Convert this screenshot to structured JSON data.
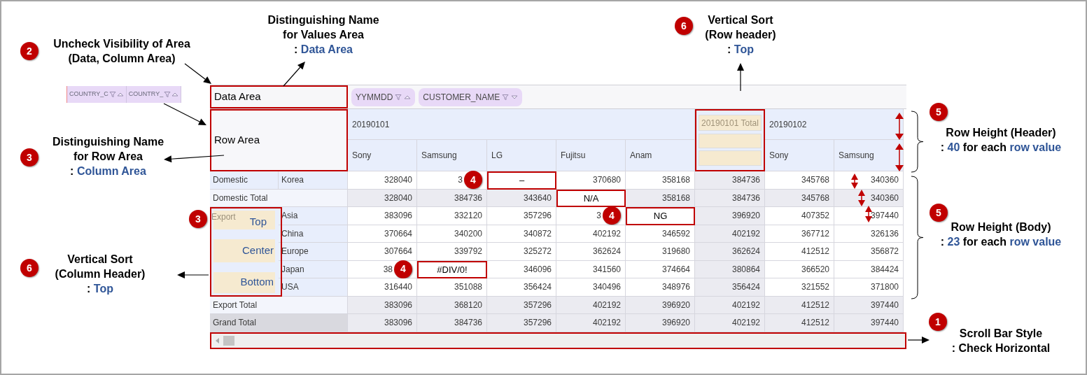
{
  "floating_fields": [
    {
      "label": "COUNTRY_C",
      "descending": false
    },
    {
      "label": "COUNTRY_",
      "descending": false
    }
  ],
  "grid": {
    "toolbar": {
      "data_area_label": "Data Area",
      "column_fields": [
        {
          "label": "YYMMDD",
          "descending": false
        },
        {
          "label": "CUSTOMER_NAME",
          "descending": true
        }
      ]
    },
    "row_area_label": "Row Area",
    "column_groups": [
      {
        "kind": "date",
        "label": "20190101",
        "members": [
          "Sony",
          "Samsung",
          "LG",
          "Fujitsu",
          "Anam"
        ]
      },
      {
        "kind": "total",
        "label": "20190101 Total"
      },
      {
        "kind": "date",
        "label": "20190102",
        "members": [
          "Sony",
          "Samsung"
        ]
      }
    ],
    "row_groups": [
      {
        "label": "Domestic",
        "rows": [
          {
            "label": "Korea",
            "cells": [
              {
                "value": "328040",
                "flagged": false
              },
              {
                "value": "3",
                "flagged": false,
                "badge": "4"
              },
              {
                "value": "–",
                "flagged": true
              },
              {
                "value": "370680",
                "flagged": false
              },
              {
                "value": "358168",
                "flagged": false
              },
              {
                "value": "384736",
                "flagged": false
              },
              {
                "value": "345768",
                "flagged": false
              },
              {
                "value": "340360",
                "flagged": false
              }
            ]
          }
        ],
        "total": {
          "label": "Domestic Total",
          "cells": [
            {
              "value": "328040",
              "flagged": false
            },
            {
              "value": "384736",
              "flagged": false
            },
            {
              "value": "343640",
              "flagged": false
            },
            {
              "value": "N/A",
              "flagged": true
            },
            {
              "value": "358168",
              "flagged": false
            },
            {
              "value": "384736",
              "flagged": false
            },
            {
              "value": "345768",
              "flagged": false
            },
            {
              "value": "340360",
              "flagged": false
            }
          ]
        }
      },
      {
        "label": "Export",
        "badge": "3",
        "alignment_samples": [
          "Top",
          "Center",
          "Bottom"
        ],
        "rows": [
          {
            "label": "Asia",
            "cells": [
              {
                "value": "383096",
                "flagged": false
              },
              {
                "value": "332120",
                "flagged": false
              },
              {
                "value": "357296",
                "flagged": false
              },
              {
                "value": "3",
                "flagged": false,
                "badge": "4"
              },
              {
                "value": "NG",
                "flagged": true
              },
              {
                "value": "396920",
                "flagged": false
              },
              {
                "value": "407352",
                "flagged": false
              },
              {
                "value": "397440",
                "flagged": false
              }
            ]
          },
          {
            "label": "China",
            "cells": [
              {
                "value": "370664",
                "flagged": false
              },
              {
                "value": "340200",
                "flagged": false
              },
              {
                "value": "340872",
                "flagged": false
              },
              {
                "value": "402192",
                "flagged": false
              },
              {
                "value": "346592",
                "flagged": false
              },
              {
                "value": "402192",
                "flagged": false
              },
              {
                "value": "367712",
                "flagged": false
              },
              {
                "value": "326136",
                "flagged": false
              }
            ]
          },
          {
            "label": "Europe",
            "cells": [
              {
                "value": "307664",
                "flagged": false
              },
              {
                "value": "339792",
                "flagged": false
              },
              {
                "value": "325272",
                "flagged": false
              },
              {
                "value": "362624",
                "flagged": false
              },
              {
                "value": "319680",
                "flagged": false
              },
              {
                "value": "362624",
                "flagged": false
              },
              {
                "value": "412512",
                "flagged": false
              },
              {
                "value": "356872",
                "flagged": false
              }
            ]
          },
          {
            "label": "Japan",
            "cells": [
              {
                "value": "38",
                "flagged": false,
                "badge": "4"
              },
              {
                "value": "#DIV/0!",
                "flagged": true
              },
              {
                "value": "346096",
                "flagged": false
              },
              {
                "value": "341560",
                "flagged": false
              },
              {
                "value": "374664",
                "flagged": false
              },
              {
                "value": "380864",
                "flagged": false
              },
              {
                "value": "366520",
                "flagged": false
              },
              {
                "value": "384424",
                "flagged": false
              }
            ]
          },
          {
            "label": "USA",
            "cells": [
              {
                "value": "316440",
                "flagged": false
              },
              {
                "value": "351088",
                "flagged": false
              },
              {
                "value": "356424",
                "flagged": false
              },
              {
                "value": "340496",
                "flagged": false
              },
              {
                "value": "348976",
                "flagged": false
              },
              {
                "value": "356424",
                "flagged": false
              },
              {
                "value": "321552",
                "flagged": false
              },
              {
                "value": "371800",
                "flagged": false
              }
            ]
          }
        ],
        "total": {
          "label": "Export Total",
          "cells": [
            {
              "value": "383096",
              "flagged": false
            },
            {
              "value": "368120",
              "flagged": false
            },
            {
              "value": "357296",
              "flagged": false
            },
            {
              "value": "402192",
              "flagged": false
            },
            {
              "value": "396920",
              "flagged": false
            },
            {
              "value": "402192",
              "flagged": false
            },
            {
              "value": "412512",
              "flagged": false
            },
            {
              "value": "397440",
              "flagged": false
            }
          ]
        }
      }
    ],
    "grand_total": {
      "label": "Grand Total",
      "cells": [
        {
          "value": "383096",
          "flagged": false
        },
        {
          "value": "384736",
          "flagged": false
        },
        {
          "value": "357296",
          "flagged": false
        },
        {
          "value": "402192",
          "flagged": false
        },
        {
          "value": "396920",
          "flagged": false
        },
        {
          "value": "402192",
          "flagged": false
        },
        {
          "value": "412512",
          "flagged": false
        },
        {
          "value": "397440",
          "flagged": false
        }
      ]
    }
  },
  "callouts": [
    {
      "badge": "2",
      "lines": [
        [
          {
            "text": "Uncheck Visibility of Area",
            "accent": false
          }
        ],
        [
          {
            "text": "(Data, Column Area)",
            "accent": false
          }
        ]
      ]
    },
    {
      "lines": [
        [
          {
            "text": "Distinguishing Name",
            "accent": false
          }
        ],
        [
          {
            "text": "for Values Area",
            "accent": false
          }
        ],
        [
          {
            "text": ": ",
            "accent": false
          },
          {
            "text": "Data Area",
            "accent": true
          }
        ]
      ]
    },
    {
      "badge": "6",
      "lines": [
        [
          {
            "text": "Vertical Sort",
            "accent": false
          }
        ],
        [
          {
            "text": "(Row header)",
            "accent": false
          }
        ],
        [
          {
            "text": ": ",
            "accent": false
          },
          {
            "text": "Top",
            "accent": true
          }
        ]
      ]
    },
    {
      "badge": "5",
      "lines": [
        [
          {
            "text": "Row Height (Header)",
            "accent": false
          }
        ],
        [
          {
            "text": ": ",
            "accent": false
          },
          {
            "text": "40",
            "accent": true
          },
          {
            "text": " for each ",
            "accent": false
          },
          {
            "text": "row value",
            "accent": true
          }
        ]
      ]
    },
    {
      "badge": "3",
      "lines": [
        [
          {
            "text": "Distinguishing Name",
            "accent": false
          }
        ],
        [
          {
            "text": "for Row Area",
            "accent": false
          }
        ],
        [
          {
            "text": ": ",
            "accent": false
          },
          {
            "text": "Column Area",
            "accent": true
          }
        ]
      ]
    },
    {
      "badge": "5",
      "lines": [
        [
          {
            "text": "Row Height (Body)",
            "accent": false
          }
        ],
        [
          {
            "text": ": ",
            "accent": false
          },
          {
            "text": "23",
            "accent": true
          },
          {
            "text": " for each ",
            "accent": false
          },
          {
            "text": "row value",
            "accent": true
          }
        ]
      ]
    },
    {
      "badge": "6",
      "lines": [
        [
          {
            "text": "Vertical Sort",
            "accent": false
          }
        ],
        [
          {
            "text": "(Column Header)",
            "accent": false
          }
        ],
        [
          {
            "text": ": ",
            "accent": false
          },
          {
            "text": "Top",
            "accent": true
          }
        ]
      ]
    },
    {
      "badge": "1",
      "lines": [
        [
          {
            "text": "Scroll Bar Style",
            "accent": false
          }
        ],
        [
          {
            "text": ": Check Horizontal",
            "accent": false
          }
        ]
      ]
    }
  ]
}
